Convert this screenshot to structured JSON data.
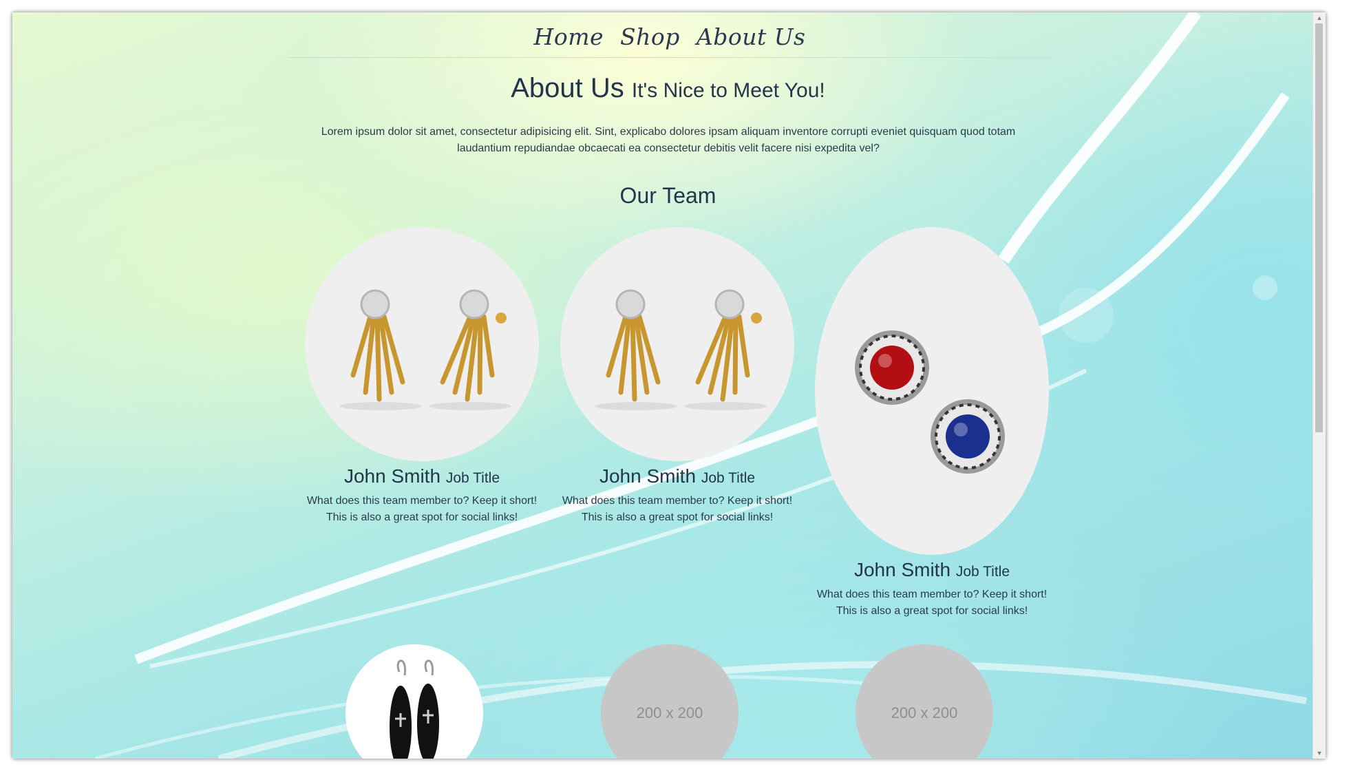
{
  "nav": {
    "home": "Home",
    "shop": "Shop",
    "about": "About Us"
  },
  "page_title": {
    "main": "About Us",
    "small": "It's Nice to Meet You!"
  },
  "intro": "Lorem ipsum dolor sit amet, consectetur adipisicing elit. Sint, explicabo dolores ipsam aliquam inventore corrupti eveniet quisquam quod totam laudantium repudiandae obcaecati ea consectetur debitis velit facere nisi expedita vel?",
  "team_heading": "Our Team",
  "members": [
    {
      "name": "John Smith",
      "title": "Job Title",
      "desc": "What does this team member to? Keep it short! This is also a great spot for social links!"
    },
    {
      "name": "John Smith",
      "title": "Job Title",
      "desc": "What does this team member to? Keep it short! This is also a great spot for social links!"
    },
    {
      "name": "John Smith",
      "title": "Job Title",
      "desc": "What does this team member to? Keep it short! This is also a great spot for social links!"
    }
  ],
  "thumbs": [
    {
      "label": ""
    },
    {
      "label": "200 x 200"
    },
    {
      "label": "200 x 200"
    }
  ],
  "colors": {
    "text": "#22354b",
    "photo_bg": "#efefef",
    "placeholder": "#c7c7c7"
  }
}
